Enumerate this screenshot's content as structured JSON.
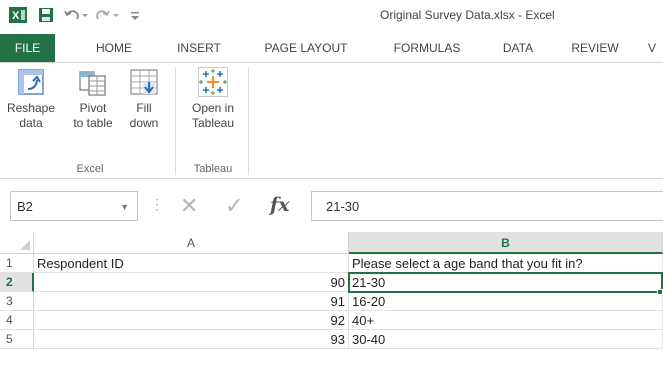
{
  "window": {
    "title": "Original Survey Data.xlsx - Excel"
  },
  "ribbon_tabs": [
    "FILE",
    "HOME",
    "INSERT",
    "PAGE LAYOUT",
    "FORMULAS",
    "DATA",
    "REVIEW",
    "V"
  ],
  "ribbon": {
    "excel_group": {
      "label": "Excel",
      "buttons": [
        {
          "line1": "Reshape",
          "line2": "data",
          "icon": "reshape-data-icon"
        },
        {
          "line1": "Pivot",
          "line2": "to table",
          "icon": "pivot-table-icon"
        },
        {
          "line1": "Fill",
          "line2": "down",
          "icon": "fill-down-icon"
        }
      ]
    },
    "tableau_group": {
      "label": "Tableau",
      "buttons": [
        {
          "line1": "Open in",
          "line2": "Tableau",
          "icon": "tableau-icon"
        }
      ]
    }
  },
  "formula_bar": {
    "name_box": "B2",
    "fx_label": "fx",
    "value": "21-30"
  },
  "grid": {
    "columns": [
      "A",
      "B"
    ],
    "selected_column": "B",
    "selected_row": "2",
    "rows": [
      {
        "num": "1",
        "a": "Respondent ID",
        "b": "Please select a age band that you fit in?"
      },
      {
        "num": "2",
        "a": "90",
        "b": "21-30"
      },
      {
        "num": "3",
        "a": "91",
        "b": "16-20"
      },
      {
        "num": "4",
        "a": "92",
        "b": "40+"
      },
      {
        "num": "5",
        "a": "93",
        "b": "30-40"
      }
    ]
  },
  "colors": {
    "excel_green": "#217346",
    "header_selected_bg": "#e1e1e1",
    "tableau_blue": "#1f77b4",
    "tableau_orange": "#f28e2b"
  }
}
